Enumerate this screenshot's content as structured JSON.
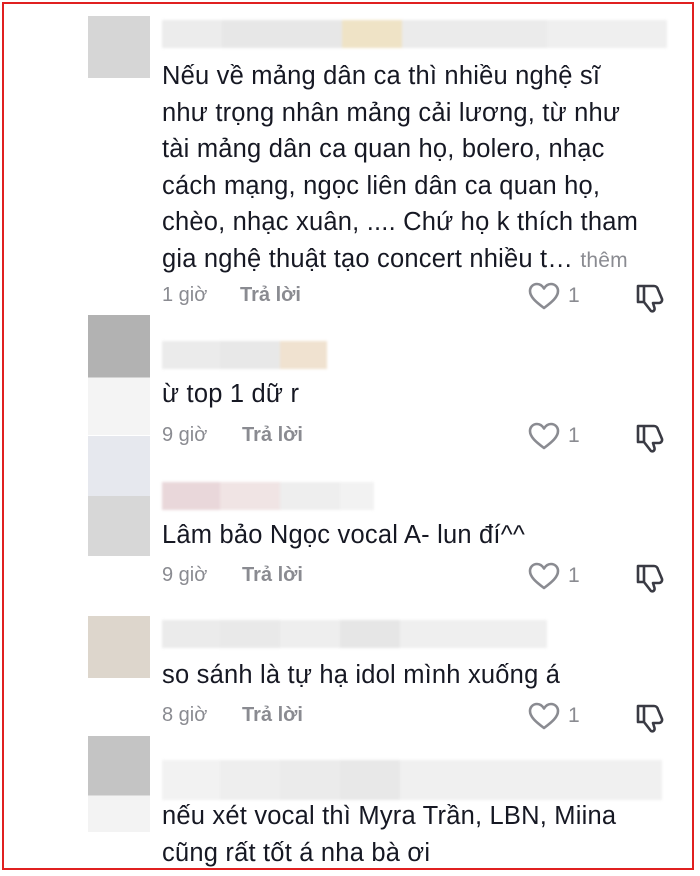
{
  "comments": [
    {
      "text_lines": [
        "Nếu về mảng dân ca thì nhiều nghệ sĩ",
        "như trọng nhân mảng cải lương, từ như",
        "tài mảng dân ca quan họ, bolero, nhạc",
        "cách mạng, ngọc liên dân ca quan họ,",
        "chèo, nhạc xuân, .... Chứ họ k thích tham",
        "gia nghệ thuật tạo concert nhiều t…"
      ],
      "more_label": "thêm",
      "time": "1 giờ",
      "reply_label": "Trả lời",
      "likes": "1"
    },
    {
      "text_lines": [
        "ừ top 1 dữ r"
      ],
      "time": "9 giờ",
      "reply_label": "Trả lời",
      "likes": "1"
    },
    {
      "text_lines": [
        "Lâm bảo Ngọc vocal A- lun đí^^"
      ],
      "time": "9 giờ",
      "reply_label": "Trả lời",
      "likes": "1"
    },
    {
      "text_lines": [
        "so sánh là tự hạ idol mình xuống á"
      ],
      "time": "8 giờ",
      "reply_label": "Trả lời",
      "likes": "1"
    },
    {
      "text_lines": [
        "nếu xét vocal thì Myra Trần, LBN, Miina",
        "cũng rất tốt á nha bà ơi"
      ]
    }
  ],
  "colors": {
    "border": "#e02020",
    "text": "#161823",
    "muted": "#8a8b91"
  },
  "icons": {
    "like": "heart-outline-icon",
    "dislike": "thumbs-down-outline-icon"
  }
}
